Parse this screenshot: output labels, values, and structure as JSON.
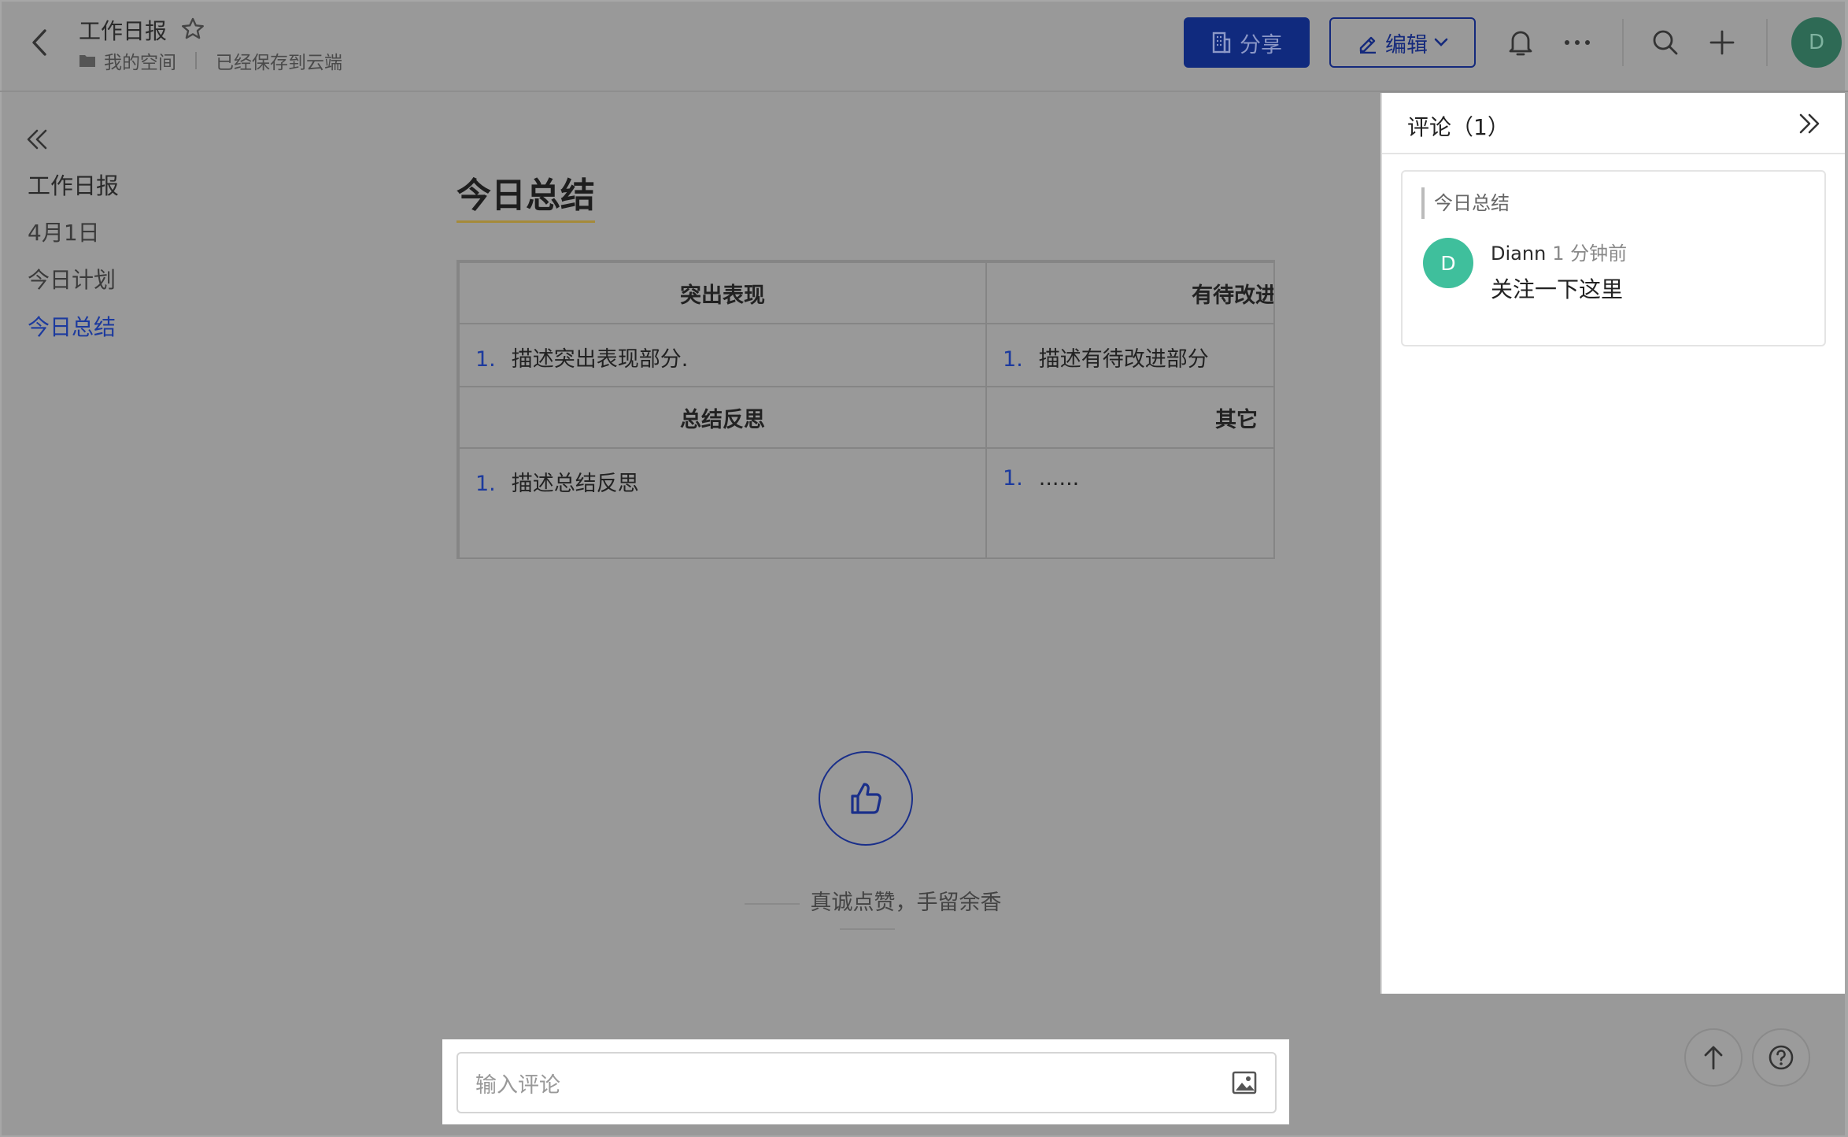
{
  "header": {
    "title": "工作日报",
    "crumb_space": "我的空间",
    "save_status": "已经保存到云端",
    "share_label": "分享",
    "edit_label": "编辑",
    "avatar_letter": "D"
  },
  "outline": {
    "items": [
      "工作日报",
      "4月1日",
      "今日计划",
      "今日总结"
    ],
    "active_index": 3
  },
  "document": {
    "heading": "今日总结",
    "table": {
      "row1_headers": [
        "突出表现",
        "有待改进"
      ],
      "row1_cells": [
        "描述突出表现部分.",
        "描述有待改进部分"
      ],
      "row2_headers": [
        "总结反思",
        "其它"
      ],
      "row2_cells": [
        "描述总结反思",
        "......"
      ],
      "list_number": "1."
    },
    "like_text": "真诚点赞，手留余香"
  },
  "comment_input": {
    "placeholder": "输入评论"
  },
  "comments_panel": {
    "title": "评论（1）",
    "quote": "今日总结",
    "author_initial": "D",
    "author": "Diann",
    "time": "1 分钟前",
    "text": "关注一下这里"
  },
  "colors": {
    "accent": "#14297c",
    "active_link": "#1c3a9e",
    "avatar_green": "#3fbf9c"
  }
}
